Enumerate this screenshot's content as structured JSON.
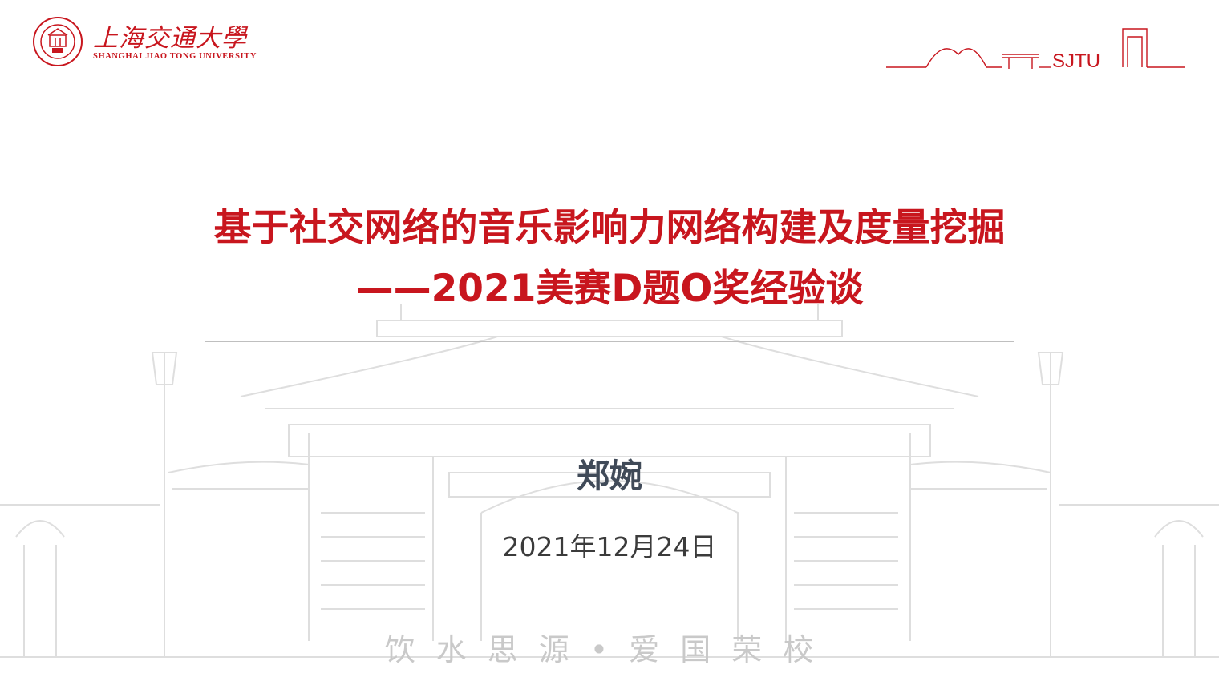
{
  "header": {
    "university_cn": "上海交通大學",
    "university_en": "SHANGHAI JIAO TONG UNIVERSITY",
    "sjtu_mark": "SJTU"
  },
  "slide": {
    "title_line1": "基于社交网络的音乐影响力网络构建及度量挖掘",
    "title_line2": "——2021美赛D题O奖经验谈",
    "author": "郑婉",
    "date": "2021年12月24日",
    "motto": "饮水思源•爱国荣校"
  },
  "colors": {
    "brand_red": "#c8161e",
    "author_slate": "#404a58",
    "watermark_gray": "#d9d9d9"
  },
  "icons": [
    "university-seal-icon",
    "campus-gate-line-icon",
    "gate-building-watermark"
  ]
}
